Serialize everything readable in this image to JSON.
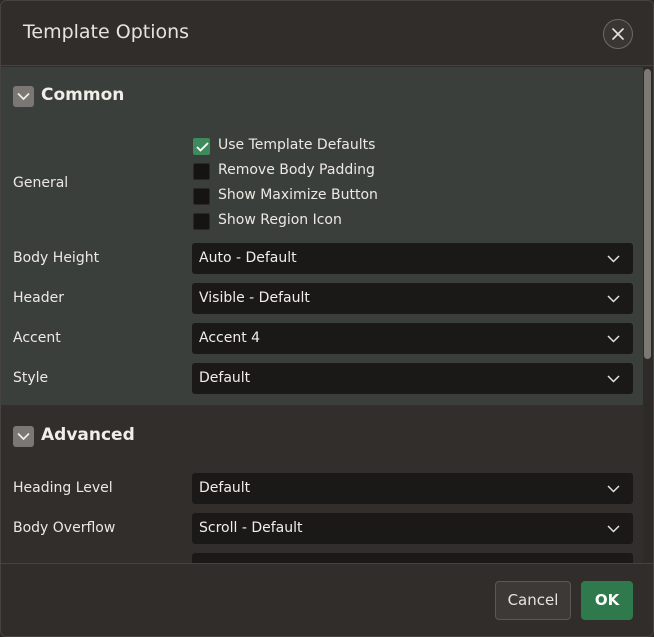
{
  "dialog": {
    "title": "Template Options",
    "close_icon": "close-icon"
  },
  "common": {
    "heading": "Common",
    "general_label": "General",
    "checkboxes": [
      {
        "label": "Use Template Defaults",
        "checked": true
      },
      {
        "label": "Remove Body Padding",
        "checked": false
      },
      {
        "label": "Show Maximize Button",
        "checked": false
      },
      {
        "label": "Show Region Icon",
        "checked": false
      }
    ],
    "fields": [
      {
        "label": "Body Height",
        "value": "Auto - Default"
      },
      {
        "label": "Header",
        "value": "Visible - Default"
      },
      {
        "label": "Accent",
        "value": "Accent 4"
      },
      {
        "label": "Style",
        "value": "Default"
      }
    ]
  },
  "advanced": {
    "heading": "Advanced",
    "fields": [
      {
        "label": "Heading Level",
        "value": "Default"
      },
      {
        "label": "Body Overflow",
        "value": "Scroll - Default"
      }
    ]
  },
  "footer": {
    "cancel_label": "Cancel",
    "ok_label": "OK"
  },
  "colors": {
    "accent_green": "#2f7a4d",
    "checkbox_checked": "#3f8a5c",
    "background": "#312d2a",
    "section_highlight": "#3b3f3b"
  }
}
